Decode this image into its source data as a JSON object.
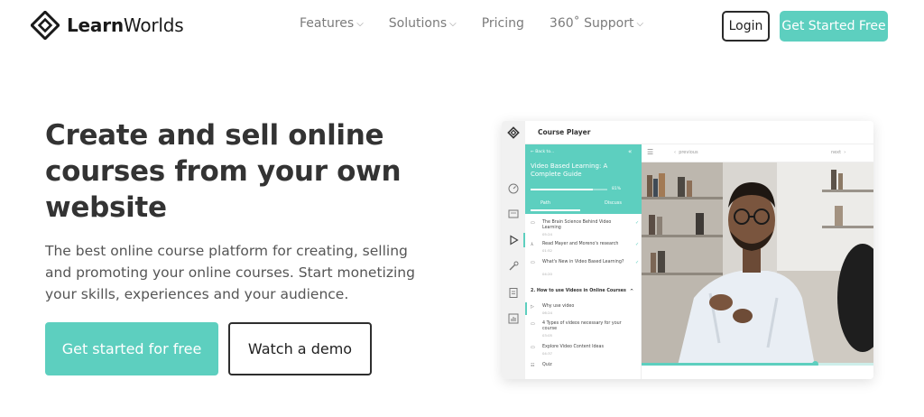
{
  "brand": {
    "name_bold": "Learn",
    "name_rest": "Worlds",
    "accent": "#5dcfbf",
    "dark": "#1f1f1f"
  },
  "nav": {
    "items": [
      {
        "label": "Features",
        "has_dropdown": true
      },
      {
        "label": "Solutions",
        "has_dropdown": true
      },
      {
        "label": "Pricing",
        "has_dropdown": false
      },
      {
        "label": "360˚ Support",
        "has_dropdown": true
      }
    ],
    "login": "Login",
    "cta": "Get Started Free"
  },
  "hero": {
    "title": "Create and sell online courses from your own website",
    "description": "The best online course platform for creating, selling and promoting your online courses. Start monetizing your skills, experiences and your audience.",
    "primary_button": "Get started for free",
    "secondary_button": "Watch a demo"
  },
  "player": {
    "header_title": "Course Player",
    "back_label": "Back to...",
    "course_title": "Video Based Learning: A Complete Guide",
    "progress_value": 0.81,
    "progress_label": "81%",
    "tabs": {
      "path": "Path",
      "discuss": "Discuss"
    },
    "lessons_top": [
      {
        "title": "The Brain Science Behind Video Learning",
        "duration": "05:24",
        "done": true
      },
      {
        "title": "Read Mayer and Moreno's research",
        "duration": "01:52",
        "done": true
      },
      {
        "title": "What's New in Video Based Learning?",
        "duration": "04:20",
        "done": true
      }
    ],
    "section_title": "2. How to use Videos in Online Courses",
    "lessons_section": [
      {
        "title": "Why use video",
        "duration": "06:24",
        "active": true
      },
      {
        "title": "4 Types of videos necessary for your course",
        "duration": "03:05"
      },
      {
        "title": "Explore Video Content Ideas",
        "duration": "04:37"
      },
      {
        "title": "Quiz",
        "duration": ""
      }
    ],
    "nav_previous": "previous",
    "nav_next": "next",
    "video_progress": 0.75
  }
}
